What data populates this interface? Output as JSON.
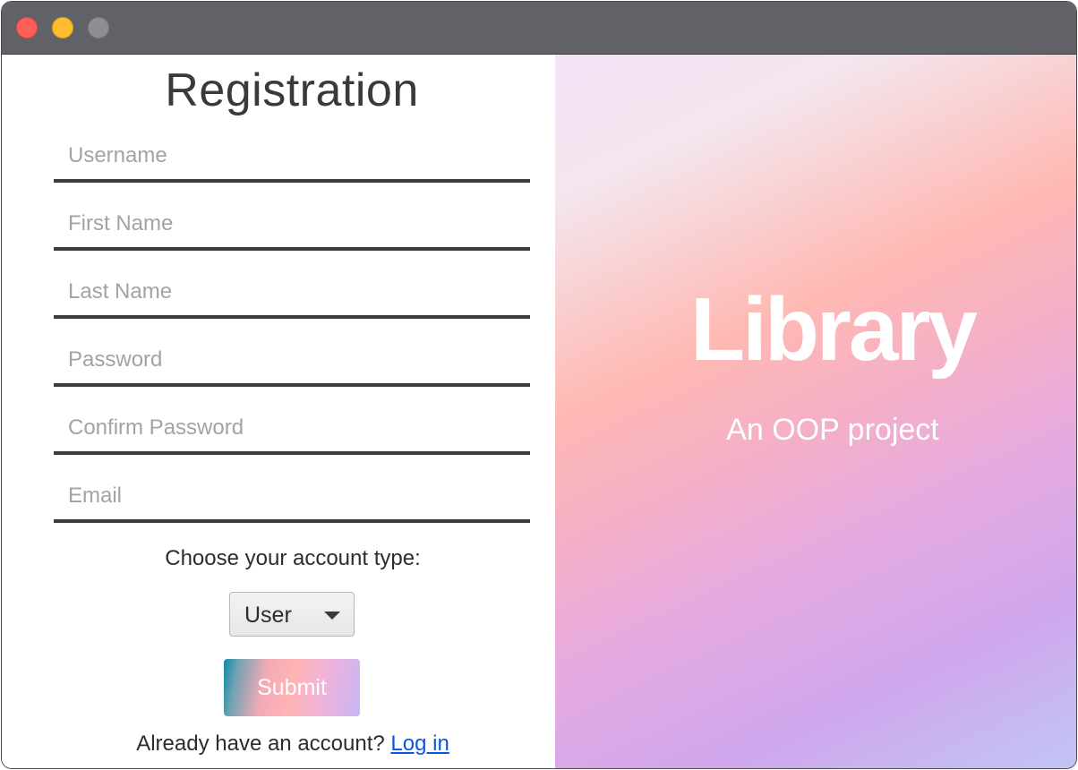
{
  "window": {
    "controls": {
      "close": "close-button",
      "minimize": "minimize-button",
      "zoom": "zoom-button"
    }
  },
  "form": {
    "title": "Registration",
    "fields": {
      "username": {
        "value": "",
        "placeholder": "Username"
      },
      "first_name": {
        "value": "",
        "placeholder": "First Name"
      },
      "last_name": {
        "value": "",
        "placeholder": "Last Name"
      },
      "password": {
        "value": "",
        "placeholder": "Password"
      },
      "confirm_password": {
        "value": "",
        "placeholder": "Confirm Password"
      },
      "email": {
        "value": "",
        "placeholder": "Email"
      }
    },
    "account_type_label": "Choose your account type:",
    "account_type_selected": "User",
    "submit_label": "Submit",
    "login_prompt": "Already have an account?",
    "login_link": "Log in"
  },
  "brand": {
    "title": "Library",
    "subtitle": "An OOP project"
  },
  "colors": {
    "titlebar": "#616168",
    "close": "#ff5f57",
    "minimize": "#febc2e",
    "zoom": "#8d8d94",
    "link": "#0a55e6",
    "field_underline": "#3c3c3c"
  }
}
